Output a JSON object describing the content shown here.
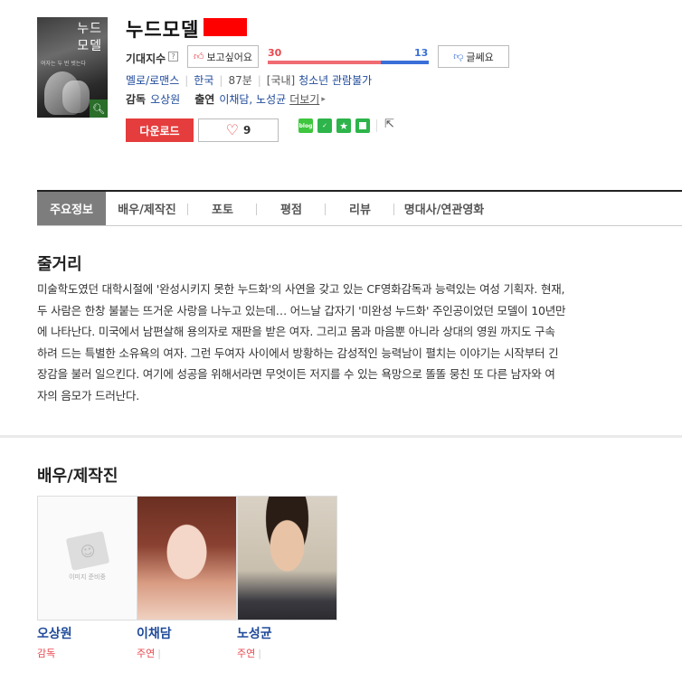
{
  "movie": {
    "title": "누드모델",
    "expect_label": "기대지수",
    "want_label": "보고싶어요",
    "nah_label": "글쎄요",
    "want_count": "30",
    "nah_count": "13",
    "want_fraction": 0.7,
    "genre": "멜로/로맨스",
    "country": "한국",
    "runtime": "87분",
    "rating_prefix": "[국내]",
    "rating": "청소년 관람불가",
    "director_label": "감독",
    "director": "오상원",
    "cast_label": "출연",
    "cast": "이채담, 노성균",
    "more_label": "더보기",
    "download_label": "다운로드",
    "like_count": "9"
  },
  "poster": {
    "title_line1": "누드",
    "title_line2": "모델",
    "subtitle": "여자는 두 번 벗는다"
  },
  "share": {
    "icons": [
      "blog-icon",
      "band-icon",
      "star-icon",
      "bookmark-icon"
    ],
    "blog_label": "blog"
  },
  "tabs": [
    "주요정보",
    "배우/제작진",
    "포토",
    "평점",
    "리뷰",
    "명대사/연관영화"
  ],
  "synopsis": {
    "title": "줄거리",
    "lines": [
      "미술학도였던 대학시절에 '완성시키지 못한 누드화'의 사연을 갖고 있는 CF영화감독과 능력있는 여성 기획자. 현재,",
      "두 사람은 한창 불붙는 뜨거운 사랑을 나누고 있는데… 어느날 갑자기 '미완성 누드화' 주인공이었던 모델이 10년만",
      "에 나타난다. 미국에서 남편살해 용의자로 재판을 받은 여자. 그리고 몸과 마음뿐 아니라 상대의 영원 까지도 구속",
      "하려 드는 특별한 소유욕의 여자. 그런 두여자 사이에서 방황하는 감성적인 능력남이 펼치는 이야기는 시작부터 긴",
      "장감을 불러 일으킨다. 여기에 성공을 위해서라면 무엇이든 저지를 수 있는 욕망으로 똘똘 뭉친 또 다른 남자와 여",
      "자의 음모가 드러난다."
    ]
  },
  "cast_section": {
    "title": "배우/제작진",
    "no_image_text": "이미지 준비중",
    "members": [
      {
        "name": "오상원",
        "role": "감독"
      },
      {
        "name": "이채담",
        "role": "주연"
      },
      {
        "name": "노성균",
        "role": "주연"
      }
    ]
  },
  "colors": {
    "accent_red": "#e53d3d",
    "link_blue": "#1f4a9a",
    "like_red": "#e8484f",
    "dislike_blue": "#3a6fd8"
  }
}
